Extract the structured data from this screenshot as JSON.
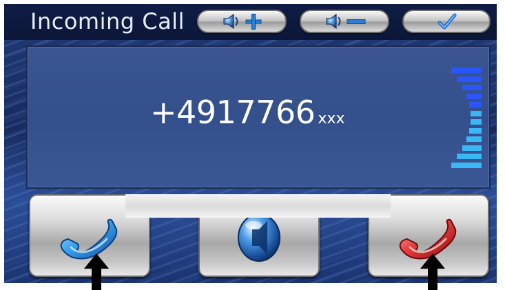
{
  "title": "Incoming Call",
  "caller": {
    "number": "+4917766",
    "masked_suffix": "xxx"
  },
  "toolbar": {
    "volume_up": {
      "icon": "speaker-plus-icon"
    },
    "volume_down": {
      "icon": "speaker-minus-icon"
    },
    "confirm": {
      "icon": "checkmark-icon"
    }
  },
  "actions": {
    "answer": {
      "icon": "phone-handset-blue-icon",
      "color": "#2f8fe0"
    },
    "speaker": {
      "icon": "speaker-icon"
    },
    "hangup": {
      "icon": "phone-handset-red-icon",
      "color": "#e03030"
    }
  },
  "signal": {
    "bars": 12,
    "level": 1.0,
    "colors": [
      "#2a56ff",
      "#39b8f5"
    ]
  },
  "colors": {
    "background": "#1b3470",
    "panel": "#3a5590",
    "text": "#ffffff"
  }
}
